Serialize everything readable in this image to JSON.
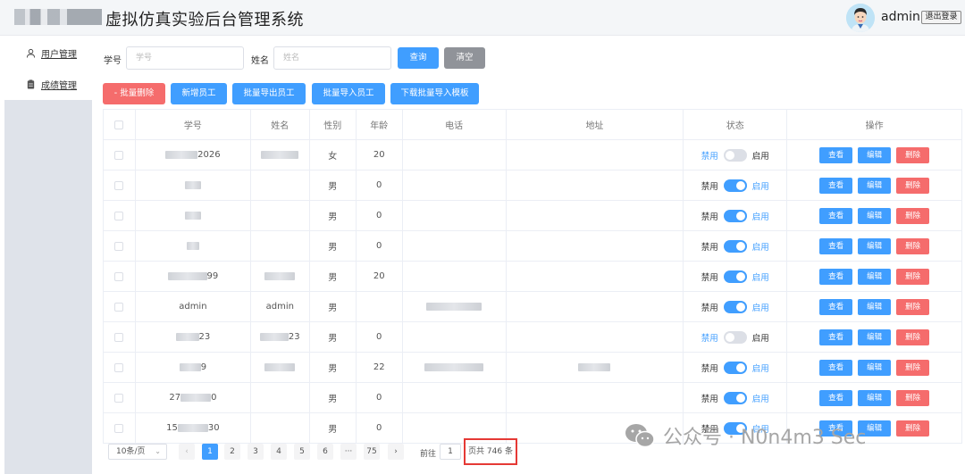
{
  "header": {
    "title": "虚拟仿真实验后台管理系统",
    "username": "admin",
    "logout_label": "退出登录"
  },
  "sidebar": {
    "items": [
      {
        "label": "用户管理",
        "icon": "user-icon"
      },
      {
        "label": "成绩管理",
        "icon": "clipboard-icon"
      }
    ]
  },
  "filters": {
    "student_id_label": "学号",
    "student_id_placeholder": "学号",
    "name_label": "姓名",
    "name_placeholder": "姓名",
    "search_label": "查询",
    "clear_label": "清空"
  },
  "toolbar": {
    "batch_delete_label": "- 批量删除",
    "add_label": "新增员工",
    "batch_export_label": "批量导出员工",
    "batch_import_label": "批量导入员工",
    "download_template_label": "下载批量导入模板"
  },
  "table": {
    "columns": [
      "学号",
      "姓名",
      "性别",
      "年龄",
      "电话",
      "地址",
      "状态",
      "操作"
    ],
    "status_off_label": "禁用",
    "status_on_label": "启用",
    "view_label": "查看",
    "edit_label": "编辑",
    "delete_label": "删除",
    "rows": [
      {
        "id": "2026",
        "name": "",
        "gender": "女",
        "age": "20",
        "enabled": false
      },
      {
        "id": "",
        "name": "",
        "gender": "男",
        "age": "0",
        "enabled": true
      },
      {
        "id": "",
        "name": "",
        "gender": "男",
        "age": "0",
        "enabled": true
      },
      {
        "id": "",
        "name": "",
        "gender": "男",
        "age": "0",
        "enabled": true
      },
      {
        "id": "99",
        "name": "",
        "gender": "男",
        "age": "20",
        "enabled": true
      },
      {
        "id": "admin",
        "name": "admin",
        "gender": "男",
        "age": "",
        "enabled": true
      },
      {
        "id": "23",
        "name": "23",
        "gender": "男",
        "age": "0",
        "enabled": false
      },
      {
        "id": "9",
        "name": "",
        "gender": "男",
        "age": "22",
        "enabled": true
      },
      {
        "id": "27 0",
        "name": "",
        "gender": "男",
        "age": "0",
        "enabled": true
      },
      {
        "id": "15 30",
        "name": "",
        "gender": "男",
        "age": "0",
        "enabled": true
      }
    ]
  },
  "pagination": {
    "page_size": "10条/页",
    "pages": [
      "1",
      "2",
      "3",
      "4",
      "5",
      "6",
      "···",
      "75"
    ],
    "current_page": "1",
    "goto_label": "前往",
    "goto_value": "1",
    "total_text": "页共 746 条"
  },
  "watermark": {
    "text": "公众号 · N0n4m3 Sec"
  },
  "colors": {
    "primary": "#409eff",
    "danger": "#f56c6c",
    "neutral": "#909399",
    "highlight_border": "#e53935"
  }
}
